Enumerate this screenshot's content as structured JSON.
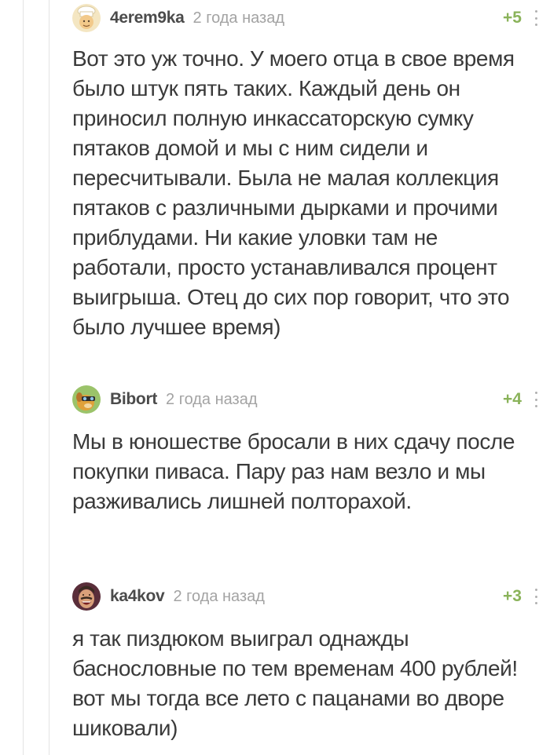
{
  "comments": [
    {
      "author": "4erem9ka",
      "time": "2 года назад",
      "rating": "+5",
      "avatar_icon": "cook-avatar-icon",
      "text": "Вот это уж точно. У моего отца в свое время было штук пять таких. Каждый день он приносил полную инкассаторскую сумку пятаков домой и мы с ним сидели и пересчитывали. Была не малая коллекция пятаков с различными дырками и прочими приблудами. Ни какие уловки там не работали, просто устанавливался процент выигрыша. Отец до сих пор говорит, что это было лучшее время)"
    },
    {
      "author": "Bibort",
      "time": "2 года назад",
      "rating": "+4",
      "avatar_icon": "cartoon-dog-avatar-icon",
      "text": "Мы в юношестве бросали в них сдачу после покупки пиваса. Пару раз нам везло и мы разживались лишней полторахой."
    },
    {
      "author": "ka4kov",
      "time": "2 года назад",
      "rating": "+3",
      "avatar_icon": "laughing-man-avatar-icon",
      "text": "я так пиздюком выиграл однажды баснословные по тем временам 400 рублей! вот мы тогда все лето с пацанами во дворе шиковали)"
    }
  ],
  "colors": {
    "rating": "#8ab35a",
    "author": "#4b4b4b",
    "time": "#a3a3a3",
    "text": "#3a3a3a"
  }
}
